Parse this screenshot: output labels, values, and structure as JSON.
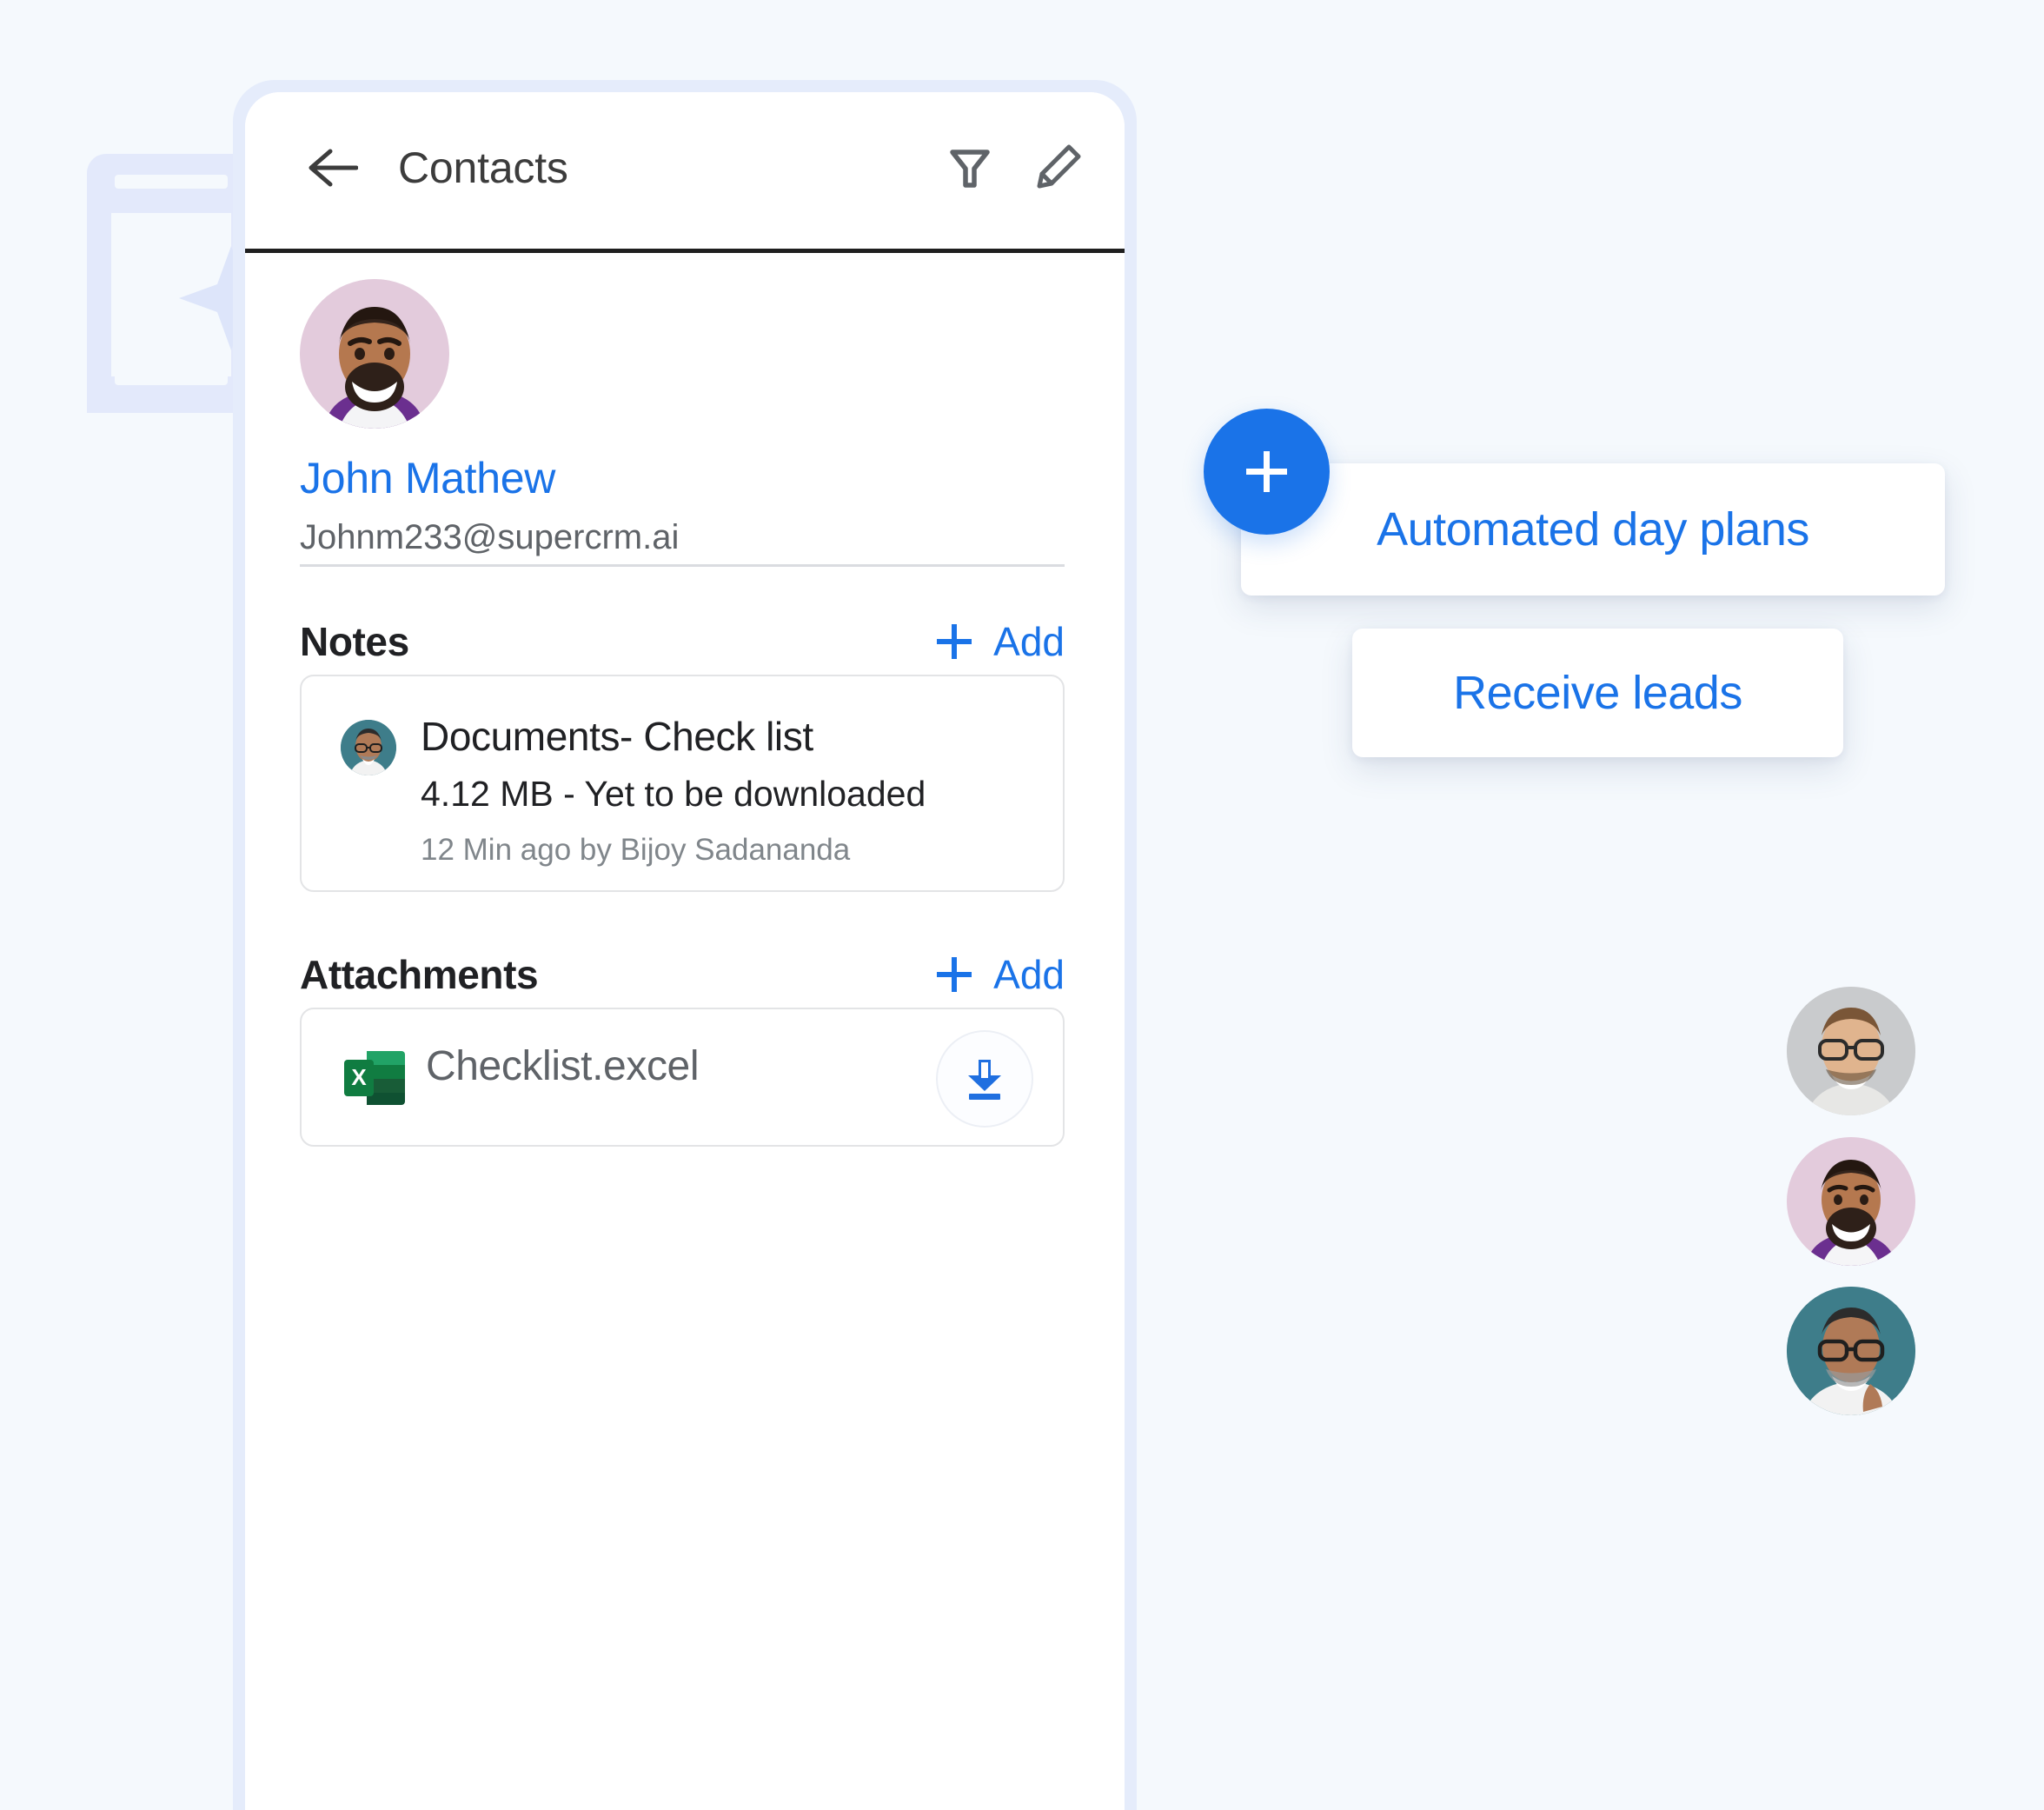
{
  "app": {
    "title": "Contacts",
    "back_icon": "arrow-left-icon",
    "filter_icon": "filter-funnel-icon",
    "edit_icon": "pencil-edit-icon"
  },
  "colors": {
    "accent_blue": "#1a73e8",
    "page_background": "#f5f9fd",
    "frame_border": "#e5ecfb",
    "text_primary": "#202124",
    "text_secondary": "#5f6368",
    "text_muted": "#80868b",
    "card_border": "#e3e4e6",
    "excel_green": "#1d6f42"
  },
  "contact": {
    "avatar": "contact-avatar-john-mathew",
    "avatar_background": "#e8d4e2",
    "name": "John Mathew",
    "email": "Johnm233@supercrm.ai"
  },
  "fab": {
    "icon": "plus-icon",
    "background": "#1a73e8"
  },
  "action_menu": {
    "items": [
      {
        "label": "Automated day plans"
      },
      {
        "label": "Receive leads"
      }
    ]
  },
  "notes": {
    "section_title": "Notes",
    "add_label": "Add",
    "add_icon": "plus-icon",
    "items": [
      {
        "author_avatar": "note-author-avatar",
        "author_avatar_background": "#3e7d8a",
        "title": "Documents- Check list",
        "subtitle": "4.12 MB - Yet to be downloaded",
        "meta": "12 Min ago by Bijoy Sadananda"
      }
    ]
  },
  "attachments": {
    "section_title": "Attachments",
    "add_label": "Add",
    "add_icon": "plus-icon",
    "items": [
      {
        "file_icon": "excel-file-icon",
        "file_icon_letter": "X",
        "name": "Checklist.excel",
        "action_icon": "download-icon"
      }
    ]
  },
  "floating_avatars": [
    {
      "name": "avatar-glasses-grey",
      "background": "#c9cbcd"
    },
    {
      "name": "avatar-pink-bg",
      "background": "#e8d4e2"
    },
    {
      "name": "avatar-teal-bg",
      "background": "#3e7d8a"
    }
  ],
  "decoration": {
    "watermark": "phone-sparkle-watermark"
  }
}
